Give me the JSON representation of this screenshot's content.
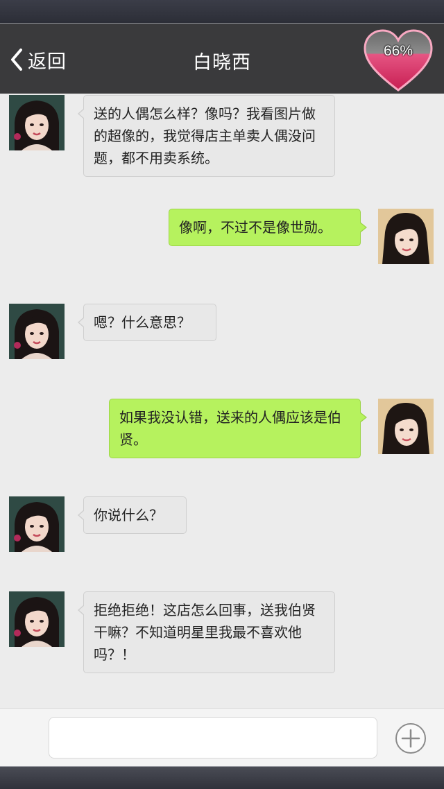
{
  "header": {
    "back_label": "返回",
    "title": "白晓西",
    "affection_percent": "66%"
  },
  "messages": [
    {
      "side": "incoming",
      "text": "送的人偶怎么样？像吗？我看图片做的超像的，我觉得店主单卖人偶没问题，都不用卖系统。"
    },
    {
      "side": "outgoing",
      "text": "像啊，不过不是像世勋。"
    },
    {
      "side": "incoming",
      "text": "嗯？什么意思？"
    },
    {
      "side": "outgoing",
      "text": "如果我没认错，送来的人偶应该是伯贤。"
    },
    {
      "side": "incoming",
      "text": "你说什么？"
    },
    {
      "side": "incoming",
      "text": "拒绝拒绝！这店怎么回事，送我伯贤干嘛？不知道明星里我最不喜欢他吗？！"
    }
  ],
  "input": {
    "value": "",
    "placeholder": ""
  },
  "icons": {
    "back": "chevron-left-icon",
    "affection": "heart-icon",
    "add": "plus-circle-icon"
  },
  "colors": {
    "header_bg": "#3a3a3c",
    "chat_bg": "#ececec",
    "incoming_bubble": "#e8e8e8",
    "outgoing_bubble": "#b6f25e",
    "heart": "#e23d6e"
  }
}
